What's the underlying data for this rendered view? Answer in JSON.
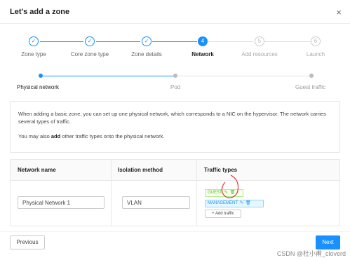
{
  "dialog": {
    "title": "Let's add a zone",
    "close_glyph": "×"
  },
  "steps": [
    {
      "label": "Zone type",
      "state": "done",
      "glyph": "✓"
    },
    {
      "label": "Core zone type",
      "state": "done",
      "glyph": "✓"
    },
    {
      "label": "Zone details",
      "state": "done",
      "glyph": "✓"
    },
    {
      "label": "Network",
      "state": "active",
      "glyph": "4"
    },
    {
      "label": "Add resources",
      "state": "todo",
      "glyph": "5"
    },
    {
      "label": "Launch",
      "state": "todo",
      "glyph": "6"
    }
  ],
  "substeps": [
    {
      "label": "Physical network",
      "state": "active"
    },
    {
      "label": "Pod",
      "state": "todo"
    },
    {
      "label": "Guest traffic",
      "state": "todo"
    }
  ],
  "info": {
    "para1": "When adding a basic zone, you can set up one physical network, which corresponds to a NIC on the hypervisor. The network carries several types of traffic.",
    "para2_prefix": "You may also ",
    "para2_bold": "add",
    "para2_suffix": " other traffic types onto the physical network."
  },
  "table": {
    "headers": {
      "name": "Network name",
      "isolation": "Isolation method",
      "traffic": "Traffic types"
    },
    "row": {
      "name_value": "Physical Network 1",
      "isolation_value": "VLAN",
      "traffic_tags": [
        {
          "label": "GUEST",
          "color": "#52c41a"
        },
        {
          "label": "MANAGEMENT",
          "color": "#1890ff"
        }
      ],
      "add_traffic_label": "+ Add traffic"
    }
  },
  "buttons": {
    "previous": "Previous",
    "next": "Next"
  },
  "watermark": "CSDN @杜小甫_cloverd",
  "colors": {
    "accent": "#1890ff",
    "annotation": "#d9363e"
  }
}
